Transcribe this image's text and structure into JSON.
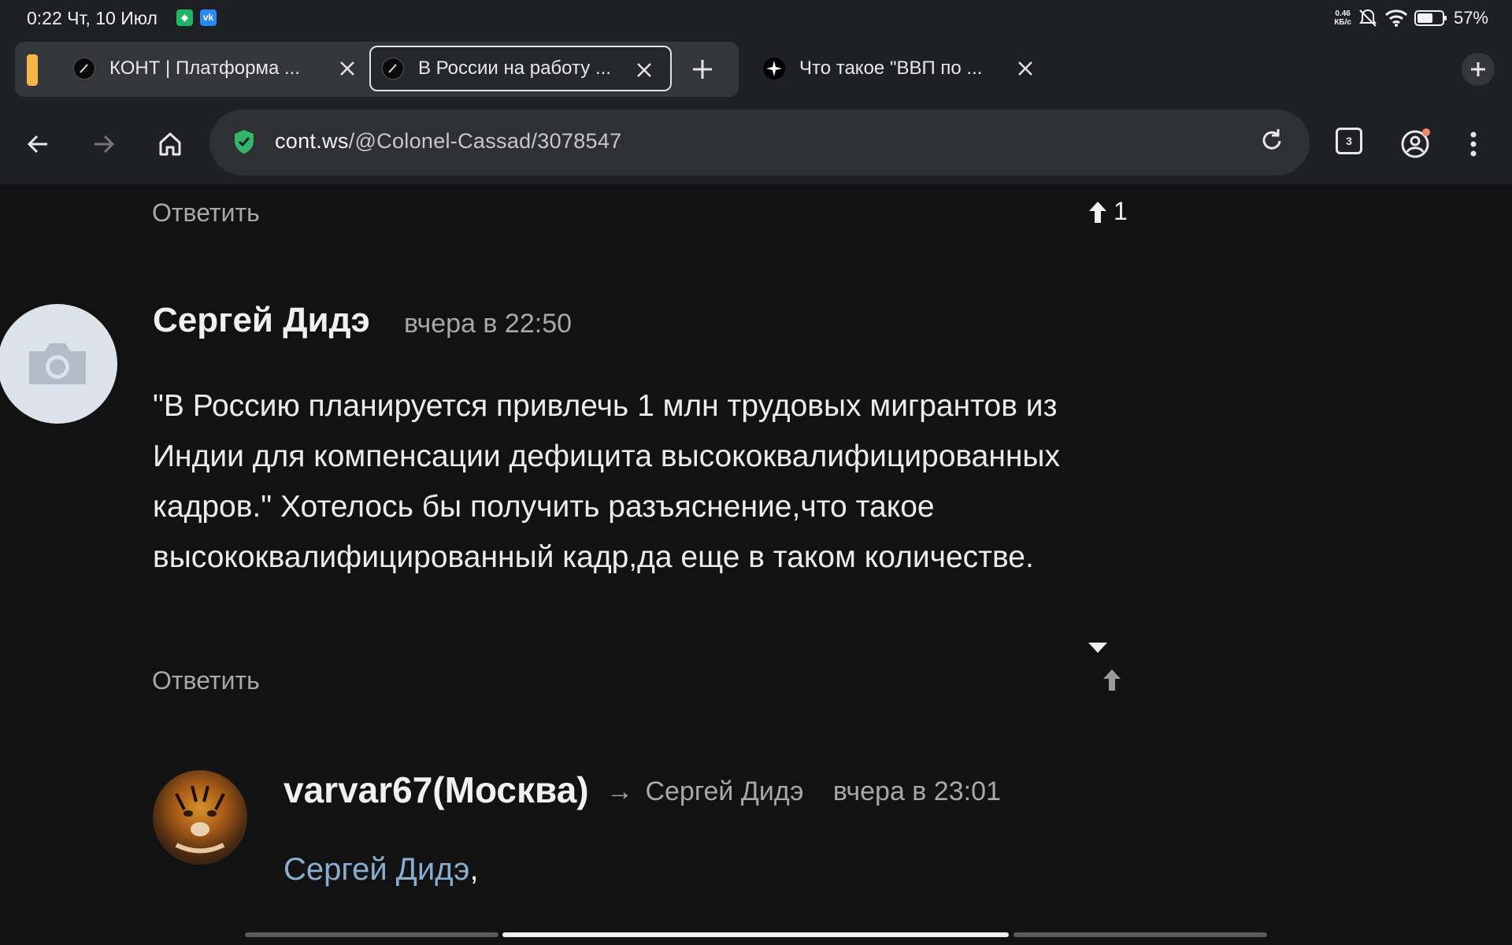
{
  "status_bar": {
    "time": "0:22 Чт, 10 Июл",
    "net_speed_value": "0.46",
    "net_speed_unit": "КБ/с",
    "battery": "57%"
  },
  "tabs": [
    {
      "title": "КОНТ | Платформа ...",
      "active": false
    },
    {
      "title": "В России на работу ...",
      "active": true
    },
    {
      "title": "Что такое \"ВВП по ...",
      "active": false
    }
  ],
  "toolbar": {
    "url_host": "cont.ws",
    "url_path": "/@Colonel-Cassad/3078547",
    "tab_count": "3"
  },
  "content": {
    "prev_reply_label": "Ответить",
    "prev_vote_count": "1",
    "comment": {
      "author": "Сергей Дидэ",
      "time": "вчера в 22:50",
      "text": "\"В Россию планируется привлечь 1 млн трудовых мигрантов из Индии для компенсации дефицита высококвалифицированных кадров.\" Хотелось бы получить разъяснение,что такое высококвалифицированный кадр,да еще в таком количестве.",
      "reply_label": "Ответить"
    },
    "reply": {
      "author": "varvar67(Москва)",
      "arrow": "→",
      "reply_to": "Сергей Дидэ",
      "time": "вчера в 23:01",
      "mention": "Сергей Дидэ",
      "mention_suffix": ","
    }
  },
  "colors": {
    "background": "#121212",
    "chrome": "#1f2023",
    "tab_group": "#f5b547",
    "link": "#8aaed0",
    "secure": "#33b56a"
  }
}
